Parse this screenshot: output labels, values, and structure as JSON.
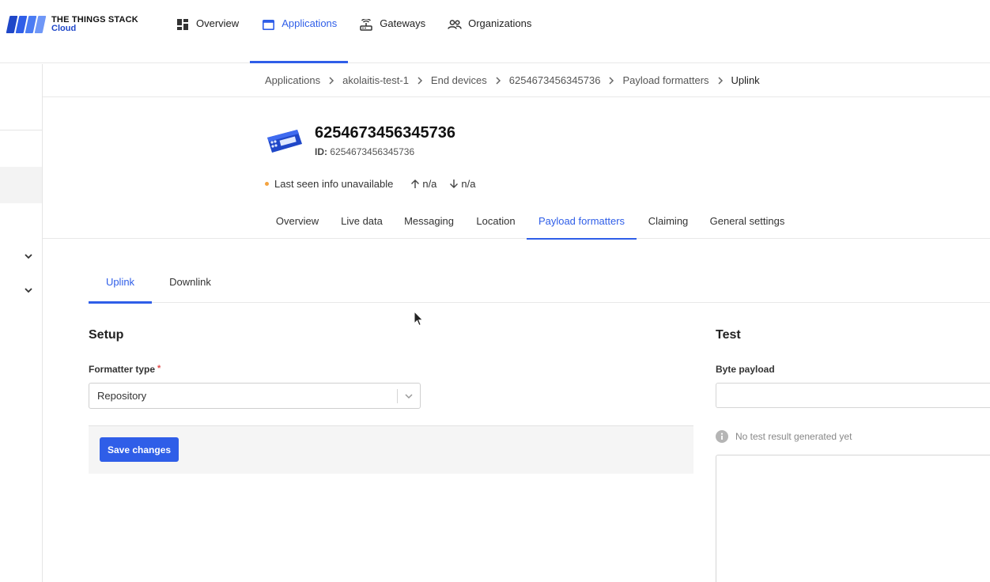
{
  "brand": {
    "title": "THE THINGS STACK",
    "subtitle": "Cloud"
  },
  "nav": {
    "items": [
      {
        "label": "Overview",
        "icon": "dashboard-icon"
      },
      {
        "label": "Applications",
        "icon": "application-icon",
        "active": true
      },
      {
        "label": "Gateways",
        "icon": "router-icon"
      },
      {
        "label": "Organizations",
        "icon": "people-icon"
      }
    ]
  },
  "breadcrumb": [
    "Applications",
    "akolaitis-test-1",
    "End devices",
    "6254673456345736",
    "Payload formatters",
    "Uplink"
  ],
  "device": {
    "name": "6254673456345736",
    "id_label": "ID:",
    "id": "6254673456345736",
    "last_seen": "Last seen info unavailable",
    "uplink": "n/a",
    "downlink": "n/a"
  },
  "device_tabs": [
    "Overview",
    "Live data",
    "Messaging",
    "Location",
    "Payload formatters",
    "Claiming",
    "General settings"
  ],
  "sub_tabs": [
    "Uplink",
    "Downlink"
  ],
  "setup": {
    "title": "Setup",
    "formatter_label": "Formatter type",
    "required_mark": "*",
    "formatter_value": "Repository",
    "save_label": "Save changes"
  },
  "test": {
    "title": "Test",
    "byte_payload_label": "Byte payload",
    "byte_payload_value": "",
    "no_result": "No test result generated yet"
  },
  "colors": {
    "accent": "#2f5ee8",
    "status_dot": "#f4a340"
  }
}
